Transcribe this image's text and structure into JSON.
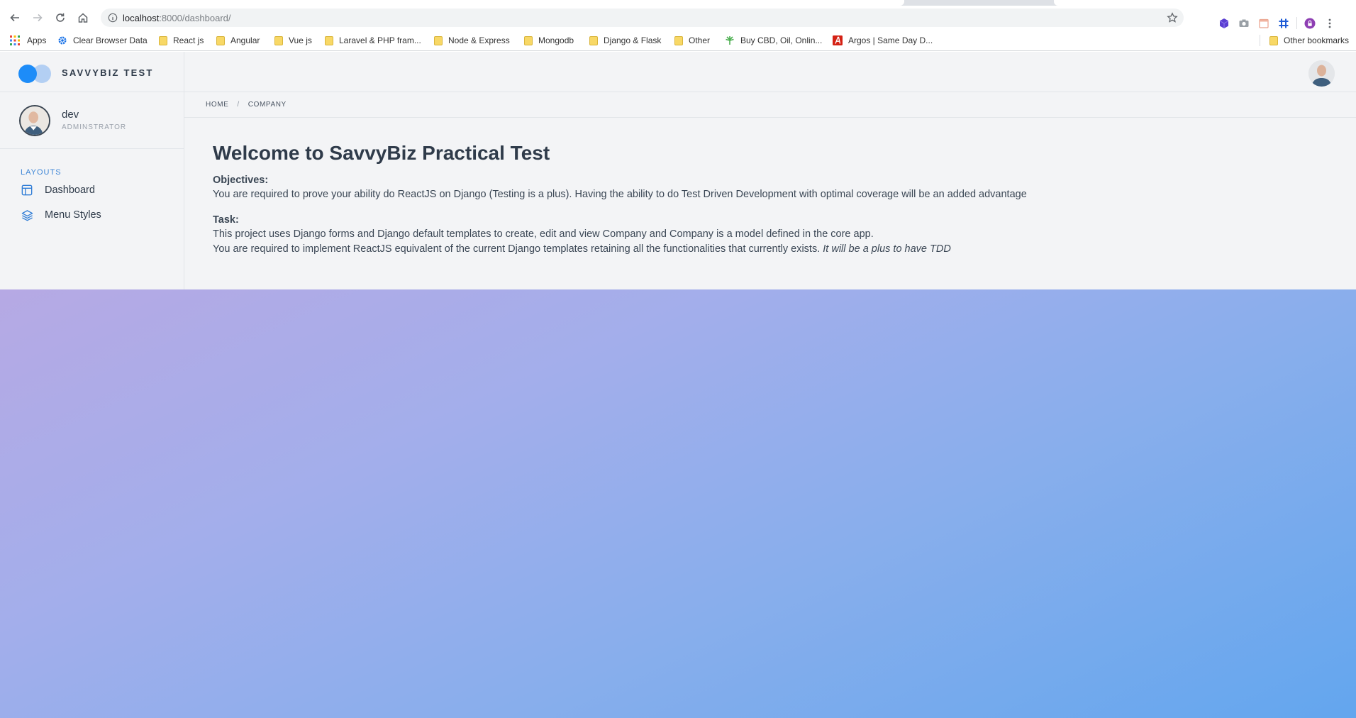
{
  "browser": {
    "url_host": "localhost",
    "url_rest": ":8000/dashboard/",
    "bookmarks": [
      {
        "label": "Apps",
        "icon": "apps-grid-icon"
      },
      {
        "label": "Clear Browser Data",
        "icon": "gear-icon"
      },
      {
        "label": "React js",
        "icon": "folder-icon"
      },
      {
        "label": "Angular",
        "icon": "folder-icon"
      },
      {
        "label": "Vue js",
        "icon": "folder-icon"
      },
      {
        "label": "Laravel & PHP fram...",
        "icon": "folder-icon"
      },
      {
        "label": "Node & Express",
        "icon": "folder-icon"
      },
      {
        "label": "Mongodb",
        "icon": "folder-icon"
      },
      {
        "label": "Django & Flask",
        "icon": "folder-icon"
      },
      {
        "label": "Other",
        "icon": "folder-icon"
      },
      {
        "label": "Buy CBD, Oil, Onlin...",
        "icon": "leaf-icon"
      },
      {
        "label": "Argos | Same Day D...",
        "icon": "argos-icon"
      }
    ],
    "other_bookmarks": "Other bookmarks"
  },
  "app": {
    "brand": "SAVVYBIZ TEST",
    "user": {
      "name": "dev",
      "role": "ADMINSTRATOR"
    },
    "sidebar": {
      "section": "LAYOUTS",
      "items": [
        {
          "label": "Dashboard",
          "icon": "layout-icon"
        },
        {
          "label": "Menu Styles",
          "icon": "layers-icon"
        }
      ]
    },
    "breadcrumb": [
      "HOME",
      "COMPANY"
    ],
    "content": {
      "title": "Welcome to SavvyBiz Practical Test",
      "objectives_label": "Objectives:",
      "objectives_text": "You are required to prove your ability do ReactJS on Django (Testing is a plus). Having the ability to do Test Driven Development with optimal coverage will be an added advantage",
      "task_label": "Task:",
      "task_line1": "This project uses Django forms and Django default templates to create, edit and view Company and Company is a model defined in the core app.",
      "task_line2": "You are required to implement ReactJS equivalent of the current Django templates retaining all the functionalities that currently exists.",
      "task_line2_em": "It will be a plus to have TDD"
    },
    "colors": {
      "accent": "#1d8cf8",
      "accent_light": "#b3cff3",
      "section": "#3e86d6"
    }
  }
}
